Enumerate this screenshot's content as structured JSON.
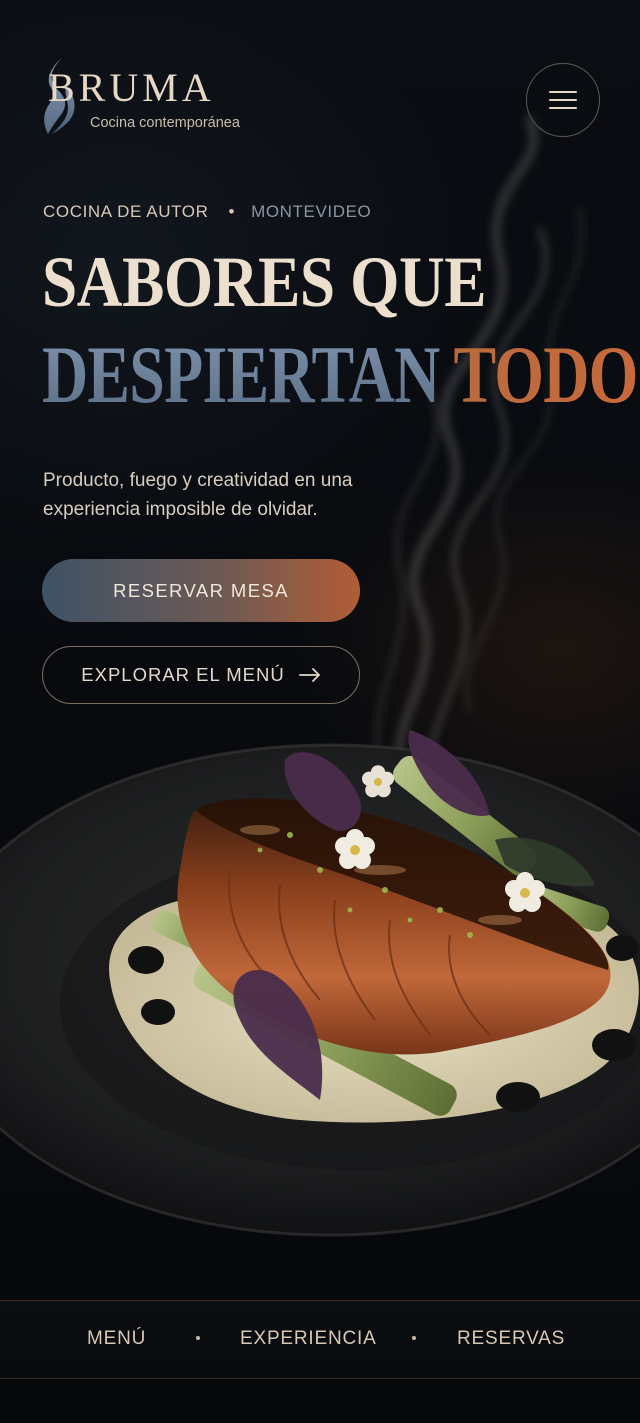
{
  "header": {
    "brand_name": "BRUMA",
    "brand_tagline": "Cocina contemporánea",
    "menu_icon": "hamburger-icon"
  },
  "hero": {
    "eyebrow_left": "COCINA DE AUTOR",
    "eyebrow_separator": "•",
    "eyebrow_right": "MONTEVIDEO",
    "headline_line1": "SABORES QUE",
    "headline_line2_part1": "DESPIERTAN",
    "headline_line2_part2": "TODO.",
    "subtitle": "Producto, fuego y creatividad en una experiencia imposible de olvidar.",
    "primary_cta": "RESERVAR MESA",
    "secondary_cta": "EXPLORAR EL MENÚ",
    "secondary_cta_icon": "arrow-right-icon"
  },
  "bottom_nav": {
    "items": [
      {
        "label": "MENÚ"
      },
      {
        "label": "EXPERIENCIA"
      },
      {
        "label": "RESERVAS"
      }
    ]
  },
  "colors": {
    "background": "#080a0e",
    "accent_copper": "#c9693b",
    "accent_steel": "#6f86a1",
    "text_cream": "#ecdfcd"
  }
}
